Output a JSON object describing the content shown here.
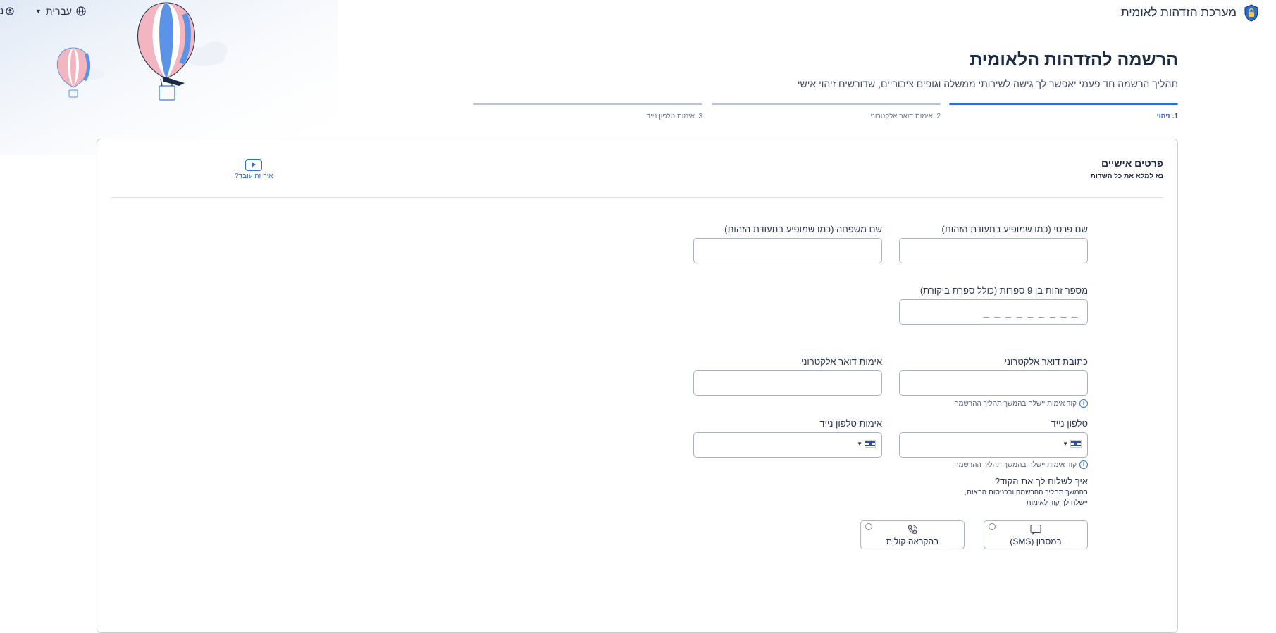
{
  "header": {
    "brand_name": "מערכת הזדהות לאומית",
    "logo_icon": "shield-lock-icon",
    "language_label": "עברית",
    "language_icon": "globe-icon",
    "accessibility_label": "נ",
    "accessibility_icon": "accessibility-icon"
  },
  "page": {
    "title": "הרשמה להזדהות הלאומית",
    "subtitle": "תהליך הרשמה חד פעמי יאפשר לך גישה לשירותי ממשלה וגופים ציבוריים, שדורשים זיהוי אישי"
  },
  "steps": [
    {
      "label": "1. זיהוי",
      "active": true
    },
    {
      "label": "2. אימות דואר אלקטרוני",
      "active": false
    },
    {
      "label": "3. אימות טלפון נייד",
      "active": false
    }
  ],
  "form": {
    "section_title": "פרטים אישיים",
    "section_subtitle": "נא למלא את כל השדות",
    "howto_label": "איך זה עובד?",
    "first_name_label": "שם פרטי (כמו שמופיע בתעודת הזהות)",
    "last_name_label": "שם משפחה (כמו שמופיע בתעודת הזהות)",
    "id_label": "מספר זהות בן 9 ספרות (כולל ספרת ביקורת)",
    "id_placeholder": "_ _ _ _ _ _ _ _ _",
    "email_label": "כתובת דואר אלקטרוני",
    "email_confirm_label": "אימות דואר אלקטרוני",
    "email_hint": "קוד אימות יישלח בהמשך תהליך ההרשמה",
    "phone_label": "טלפון נייד",
    "phone_confirm_label": "אימות טלפון נייד",
    "phone_hint": "קוד אימות יישלח בהמשך תהליך ההרשמה",
    "send_code_title": "איך לשלוח לך את הקוד?",
    "send_code_line1": "בהמשך תהליך ההרשמה ובכניסות הבאות,",
    "send_code_line2": "יישלח לך קוד לאימות",
    "option_sms": "במסרון (SMS)",
    "option_voice": "בהקראה קולית",
    "country_flag": "israel-flag-icon"
  },
  "colors": {
    "accent": "#2c70d6",
    "text": "#1b2a45",
    "border": "#a9b2c3"
  }
}
